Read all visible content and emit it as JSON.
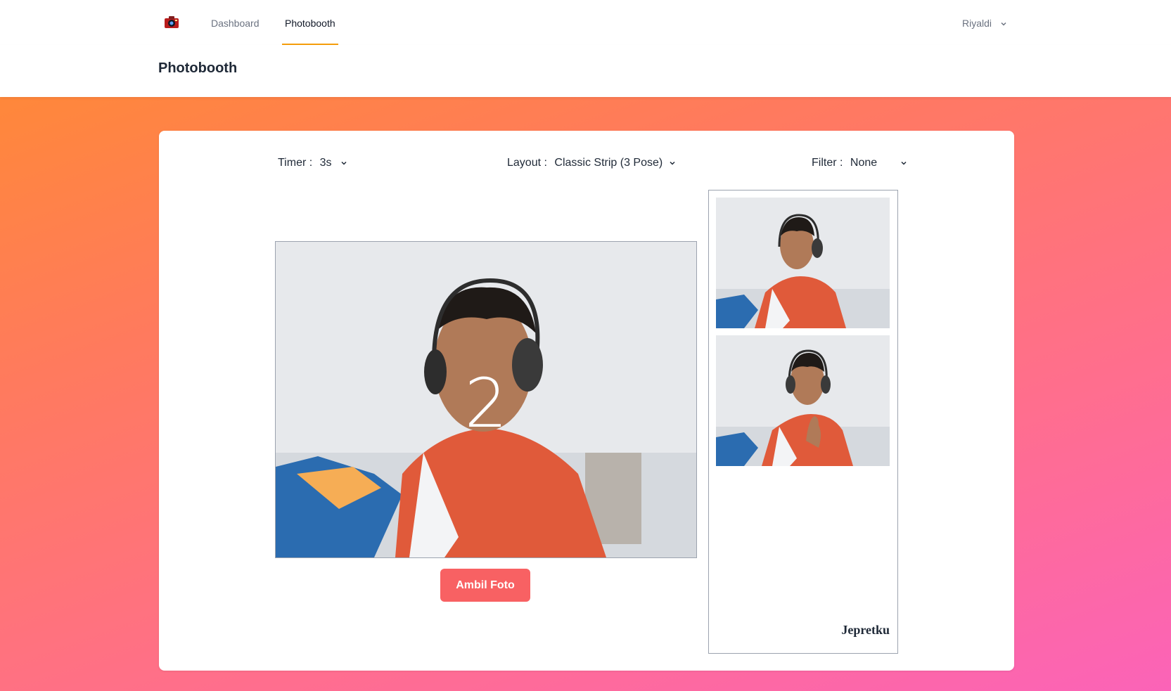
{
  "nav": {
    "links": [
      {
        "label": "Dashboard",
        "active": false
      },
      {
        "label": "Photobooth",
        "active": true
      }
    ],
    "user": "Riyaldi",
    "accent_color": "#f59e0b"
  },
  "page": {
    "title": "Photobooth"
  },
  "controls": {
    "timer": {
      "label": "Timer :",
      "value": "3s"
    },
    "layout": {
      "label": "Layout :",
      "value": "Classic Strip (3 Pose)"
    },
    "filter": {
      "label": "Filter :",
      "value": "None"
    }
  },
  "camera": {
    "countdown": "2",
    "capture_label": "Ambil Foto",
    "capture_color": "#f86163"
  },
  "strip": {
    "photos_taken": 2,
    "photos_total": 3,
    "brand": "Jepretku"
  }
}
